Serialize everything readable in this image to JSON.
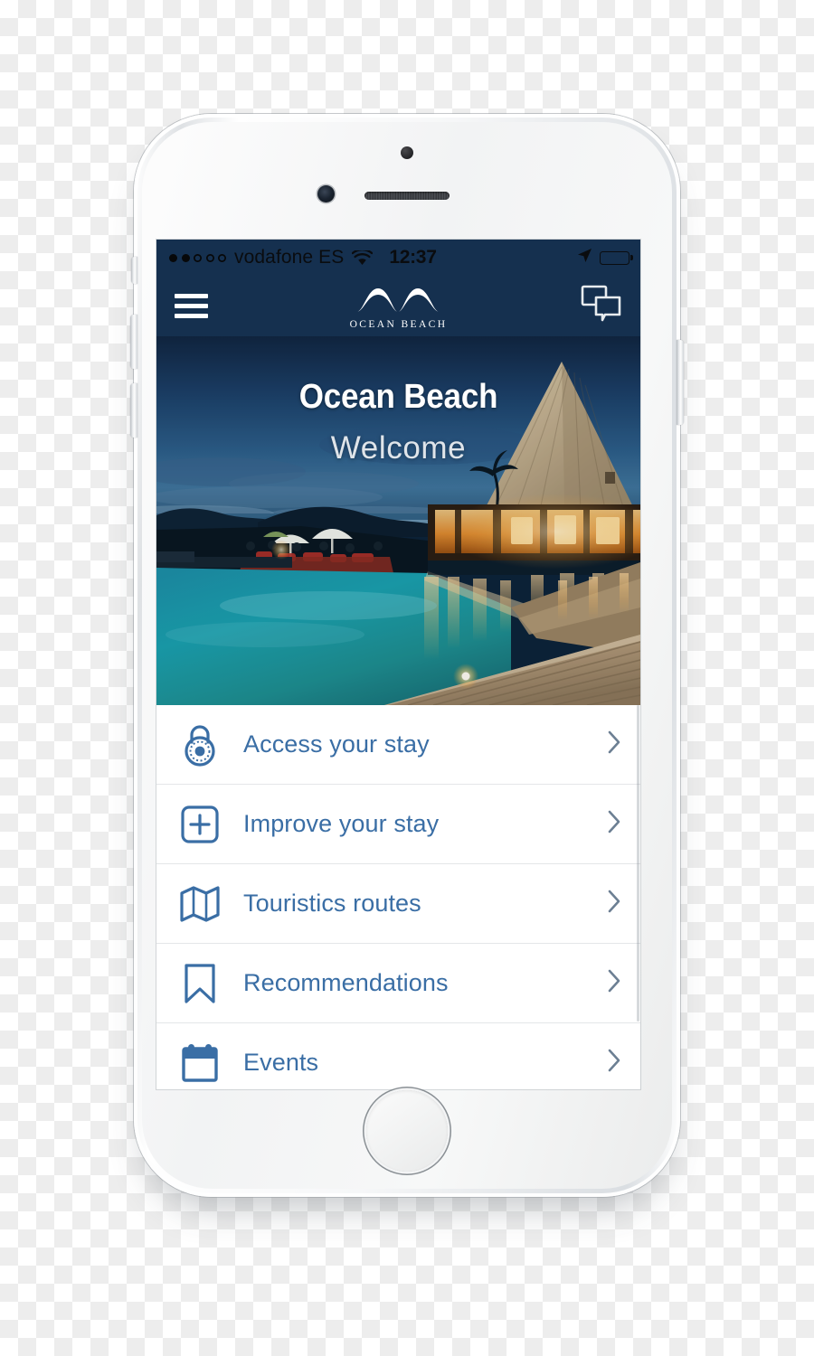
{
  "device": {
    "name": "white-iphone-mockup",
    "sensors": [
      "sensor-dot",
      "front-camera",
      "earpiece-speaker"
    ],
    "buttons": [
      "mute-switch",
      "volume-up",
      "volume-down",
      "power-button",
      "home-button"
    ]
  },
  "status_bar": {
    "signal_dots_filled": 2,
    "signal_dots_total": 5,
    "carrier": "vodafone ES",
    "wifi_icon": "wifi-icon",
    "time": "12:37",
    "location_icon": "location-arrow-icon",
    "battery_icon": "battery-full-icon",
    "battery_level": "100",
    "background_color": "#15304f"
  },
  "nav_bar": {
    "menu_icon": "hamburger-menu-icon",
    "brand_name": "OCEAN BEACH",
    "brand_logo_icon": "ocean-beach-wave-logo",
    "chat_icon": "chat-bubbles-icon",
    "background_color": "#15304f"
  },
  "hero": {
    "title": "Ocean Beach",
    "subtitle": "Welcome",
    "image_description": "tropical-resort-pool-at-dusk"
  },
  "menu": {
    "accent_color": "#3a6ea5",
    "items": [
      {
        "label": "Access your stay",
        "icon": "combination-lock-icon",
        "chevron": "chevron-right-icon"
      },
      {
        "label": "Improve your stay",
        "icon": "plus-square-icon",
        "chevron": "chevron-right-icon"
      },
      {
        "label": "Touristics routes",
        "icon": "folded-map-icon",
        "chevron": "chevron-right-icon"
      },
      {
        "label": "Recommendations",
        "icon": "bookmark-icon",
        "chevron": "chevron-right-icon"
      },
      {
        "label": "Events",
        "icon": "calendar-icon",
        "chevron": "chevron-right-icon"
      }
    ]
  }
}
